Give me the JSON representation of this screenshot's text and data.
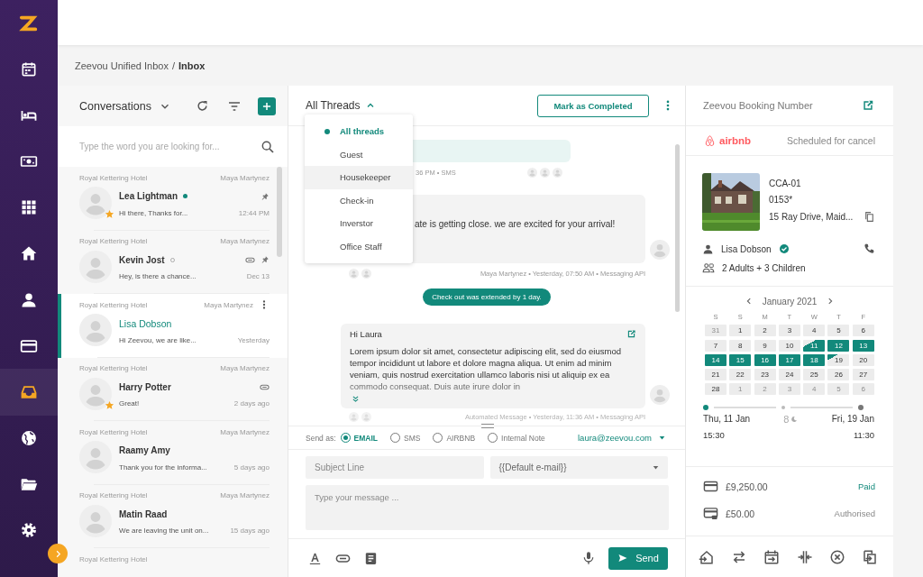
{
  "sidebar": {
    "items": [
      {
        "kind": "calendar",
        "selected": false
      },
      {
        "kind": "bed",
        "selected": false
      },
      {
        "kind": "money",
        "selected": false
      },
      {
        "kind": "grid",
        "selected": false
      },
      {
        "kind": "home",
        "selected": false
      },
      {
        "kind": "person",
        "selected": false
      },
      {
        "kind": "card",
        "selected": false
      },
      {
        "kind": "inbox",
        "selected": true
      },
      {
        "kind": "globe",
        "selected": false
      },
      {
        "kind": "folder",
        "selected": false
      },
      {
        "kind": "settings",
        "selected": false
      }
    ]
  },
  "breadcrumb": {
    "path": "Zeevou Unified Inbox",
    "separator": "/",
    "current": "Inbox"
  },
  "conversations": {
    "title": "Conversations",
    "search": {
      "placeholder": "Type the word you are looking for..."
    },
    "items": [
      {
        "kind": "conversation",
        "hotel": "Royal Kettering Hotel",
        "agent": "Maya Martynez",
        "name": "Lea Lightman",
        "preview": "Hi there, Thanks for...",
        "time": "12:44 PM",
        "online": true,
        "starred": true,
        "pinned": true,
        "attachment": false,
        "selected": false
      },
      {
        "kind": "conversation",
        "hotel": "Royal Kettering Hotel",
        "agent": "Maya Martynez",
        "name": "Kevin Jost",
        "preview": "Hey, is there a chance...",
        "time": "Dec 13",
        "online": false,
        "starred": false,
        "pinned": true,
        "attachment": true,
        "selected": false
      },
      {
        "kind": "conversation",
        "hotel": "Royal Kettering Hotel",
        "agent": "Maya Martynez",
        "name": "Lisa Dobson",
        "preview": "Hi Zeevou, we are like...",
        "time": "Yesterday",
        "starred": false,
        "pinned": false,
        "attachment": false,
        "selected": true
      },
      {
        "kind": "conversation",
        "hotel": "Royal Kettering Hotel",
        "agent": "Maya Martynez",
        "name": "Harry Potter",
        "preview": "Great!",
        "time": "2 days ago",
        "starred": true,
        "pinned": false,
        "attachment": true,
        "selected": false
      },
      {
        "kind": "conversation",
        "hotel": "Royal Kettering Hotel",
        "agent": "Maya Martynez",
        "name": "Raamy Amy",
        "preview": "Thank you for the informa...",
        "time": "5 days ago",
        "starred": false,
        "pinned": false,
        "attachment": false,
        "selected": false
      },
      {
        "kind": "conversation",
        "hotel": "Royal Kettering Hotel",
        "agent": "Maya Martynez",
        "name": "Matin Raad",
        "preview": "We are leaving the unit on...",
        "time": "15 days ago",
        "starred": false,
        "pinned": false,
        "attachment": false,
        "selected": false
      },
      {
        "kind": "cut",
        "hotel": "Royal Kettering Hotel"
      }
    ]
  },
  "thread": {
    "filter": {
      "label": "All Threads",
      "expanded": true,
      "options": [
        {
          "label": "All threads",
          "selected": true,
          "hovered": false
        },
        {
          "label": "Guest",
          "selected": false,
          "hovered": false
        },
        {
          "label": "Housekeeper",
          "selected": false,
          "hovered": true
        },
        {
          "label": "Check-in",
          "selected": false,
          "hovered": false
        },
        {
          "label": "Inverstor",
          "selected": false,
          "hovered": false
        },
        {
          "label": "Office Staff",
          "selected": false,
          "hovered": false
        }
      ]
    },
    "complete_button": "Mark as Completed",
    "messages": [
      {
        "kind": "sms",
        "meta": "36 PM • SMS"
      },
      {
        "kind": "message",
        "text": "ate is getting close. we are excited for your arrival!",
        "meta": "Maya Martynez • Yesterday, 07:50 AM • Messaging API"
      },
      {
        "kind": "event",
        "text": "Check out was extended by 1 day."
      },
      {
        "kind": "email",
        "greeting": "Hi Laura",
        "body": "Lorem ipsum dolor sit amet, consectetur adipiscing elit, sed do eiusmod tempor incididunt ut labore et dolore magna aliqua. Ut enim ad minim veniam, quis nostrud exercitation ullamco laboris nisi ut aliquip ex ea commodo consequat. Duis aute irure dolor in",
        "meta": "Automated Message • Yesterday, 11:36 AM • Messaging API"
      }
    ],
    "send_as": {
      "label": "Send as:",
      "options": [
        {
          "label": "EMAIL",
          "selected": true
        },
        {
          "label": "SMS",
          "selected": false
        },
        {
          "label": "AIRBNB",
          "selected": false
        },
        {
          "label": "Internal Note",
          "selected": false
        }
      ],
      "recipient": "laura@zeevou.com"
    },
    "subject": {
      "placeholder": "Subject Line"
    },
    "template": {
      "value": "{{Default e-mail}}"
    },
    "message": {
      "placeholder": "Type your message ..."
    },
    "send_button": "Send"
  },
  "booking": {
    "title": "Zeevou Booking Number",
    "channel": "airbnb",
    "status": "Scheduled for cancel",
    "property": {
      "code": "CCA-01",
      "unit": "0153*",
      "address": "15 Ray Drive, Maid..."
    },
    "guest": {
      "name": "Lisa Dobson",
      "verified": true
    },
    "party": "2 Adults + 3 Children",
    "calendar": {
      "month": "January 2021",
      "weekdays": [
        "S",
        "S",
        "M",
        "T",
        "W",
        "T",
        "F"
      ],
      "weeks": [
        [
          {
            "day": "31",
            "kind": "other"
          },
          {
            "day": "1",
            "kind": "day"
          },
          {
            "day": "2",
            "kind": "day"
          },
          {
            "day": "3",
            "kind": "day"
          },
          {
            "day": "4",
            "kind": "day"
          },
          {
            "day": "5",
            "kind": "day"
          },
          {
            "day": "6",
            "kind": "day"
          }
        ],
        [
          {
            "day": "7",
            "kind": "day"
          },
          {
            "day": "8",
            "kind": "day"
          },
          {
            "day": "9",
            "kind": "day"
          },
          {
            "day": "10",
            "kind": "day"
          },
          {
            "day": "11",
            "kind": "start"
          },
          {
            "day": "12",
            "kind": "range"
          },
          {
            "day": "13",
            "kind": "range"
          }
        ],
        [
          {
            "day": "14",
            "kind": "range"
          },
          {
            "day": "15",
            "kind": "range"
          },
          {
            "day": "16",
            "kind": "range"
          },
          {
            "day": "17",
            "kind": "range"
          },
          {
            "day": "18",
            "kind": "range"
          },
          {
            "day": "19",
            "kind": "end"
          },
          {
            "day": "20",
            "kind": "day"
          }
        ],
        [
          {
            "day": "21",
            "kind": "day"
          },
          {
            "day": "22",
            "kind": "day"
          },
          {
            "day": "23",
            "kind": "day"
          },
          {
            "day": "24",
            "kind": "day"
          },
          {
            "day": "25",
            "kind": "day"
          },
          {
            "day": "26",
            "kind": "day"
          },
          {
            "day": "27",
            "kind": "day"
          }
        ],
        [
          {
            "day": "28",
            "kind": "day"
          },
          {
            "day": "1",
            "kind": "other"
          },
          {
            "day": "2",
            "kind": "other"
          },
          {
            "day": "3",
            "kind": "other"
          },
          {
            "day": "4",
            "kind": "other"
          },
          {
            "day": "5",
            "kind": "other"
          },
          {
            "day": "6",
            "kind": "other"
          }
        ]
      ]
    },
    "stay": {
      "checkin_date": "Thu, 11 Jan",
      "checkin_time": "15:30",
      "nights": "8",
      "checkout_date": "Fri, 19 Jan",
      "checkout_time": "11:30"
    },
    "payments": [
      {
        "kind": "card",
        "amount": "£9,250.00",
        "status": "Paid",
        "settled": true
      },
      {
        "kind": "hold",
        "amount": "£50.00",
        "status": "Authorised",
        "settled": false
      }
    ]
  }
}
